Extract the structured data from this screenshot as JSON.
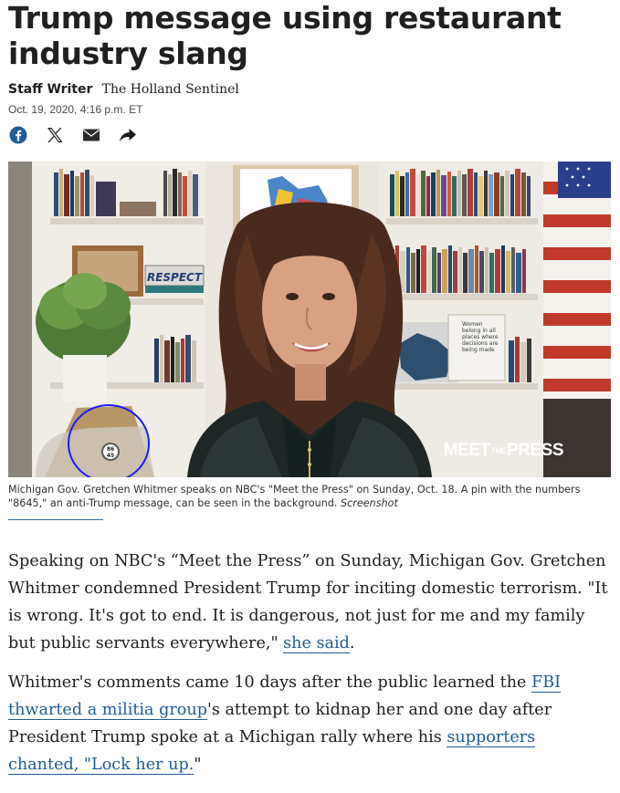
{
  "article": {
    "headline": "Trump message using restaurant industry slang",
    "author": "Staff Writer",
    "outlet": "The Holland Sentinel",
    "date": "Oct. 19, 2020, 4:16 p.m. ET"
  },
  "share_icons": [
    "facebook-icon",
    "x-icon",
    "mail-icon",
    "share-arrow-icon"
  ],
  "photo": {
    "watermark_left": "MEET",
    "watermark_mid": "THE",
    "watermark_right": "PRESS",
    "plate_text": "RESPECT",
    "pin_top": "86",
    "pin_bottom": "45",
    "book_text": "Women belong in all places where decisions are being made"
  },
  "caption": {
    "text": "Michigan Gov. Gretchen Whitmer speaks on NBC's \"Meet the Press\" on Sunday, Oct. 18. A pin with the numbers \"8645,\" an anti-Trump message, can be seen in the background.",
    "credit": "Screenshot"
  },
  "paragraphs": {
    "p1_a": "Speaking on NBC's “Meet the Press” on Sunday, Michigan Gov. Gretchen Whitmer condemned President Trump for inciting domestic terrorism. \"It is wrong. It's got to end. It is dangerous, not just for me and my family but public servants everywhere,\" ",
    "p1_link": "she said",
    "p1_b": ".",
    "p2_a": "Whitmer's comments came 10 days after the public learned the ",
    "p2_link1": "FBI thwarted a militia group",
    "p2_b": "'s attempt to kidnap her and one day after President Trump spoke at a Michigan rally where his ",
    "p2_link2": "supporters chanted, \"Lock her up.",
    "p2_c": "\""
  },
  "colors": {
    "link": "#1f5c99",
    "annotation_circle": "#1a1aff",
    "facebook": "#1f5c99"
  }
}
